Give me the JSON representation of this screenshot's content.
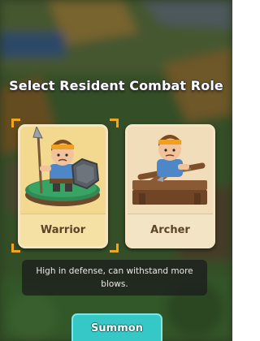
{
  "dialog": {
    "title": "Select Resident Combat Role",
    "selected_role": "Warrior",
    "roles": [
      {
        "label": "Warrior"
      },
      {
        "label": "Archer"
      }
    ],
    "description": "High in defense, can withstand more blows.",
    "summon_label": "Summon"
  },
  "colors": {
    "selection_corners": "#f2a51c",
    "summon_button": "#35c8c6",
    "card_border": "#f4e6c4"
  },
  "icons": [
    "warrior-character-icon",
    "archer-character-icon"
  ]
}
